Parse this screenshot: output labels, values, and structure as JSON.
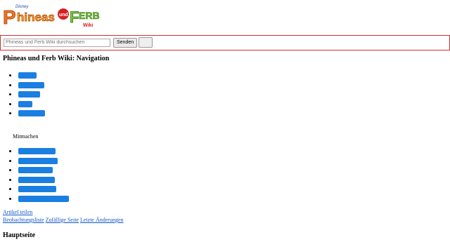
{
  "logo": {
    "alt": "Phineas und Ferb Wiki",
    "text_main": "hineas",
    "text_und": "und",
    "text_ferb": "ERB",
    "text_wiki": "Wiki",
    "text_disney": "Disney"
  },
  "search": {
    "placeholder": "Phineas und Ferb Wiki durchsuchen",
    "button_label": "Senden"
  },
  "navigation": {
    "title": "Phineas und Ferb Wiki: Navigation"
  },
  "nav_items": [
    {
      "label": ""
    },
    {
      "label": ""
    },
    {
      "label": ""
    },
    {
      "label": ""
    },
    {
      "label": ""
    }
  ],
  "mitmachen": {
    "label": "Mitmachen"
  },
  "mitmachen_items": [
    {
      "label": ""
    },
    {
      "label": ""
    },
    {
      "label": ""
    },
    {
      "label": ""
    },
    {
      "label": ""
    },
    {
      "label": ""
    }
  ],
  "links": {
    "share": "Artikel teilen",
    "watchlist": "Beobachtungsliste",
    "random": "Zufällige Seite",
    "recent": "Letzte Änderungen"
  },
  "page": {
    "heading": "Hauptseite"
  },
  "colors": {
    "accent": "#1a7fe0",
    "search_border": "#cc3333",
    "link": "#1155cc"
  }
}
